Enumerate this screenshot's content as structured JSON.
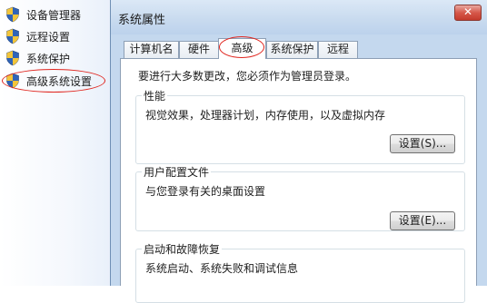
{
  "sidebar": {
    "items": [
      {
        "label": "设备管理器"
      },
      {
        "label": "远程设置"
      },
      {
        "label": "系统保护"
      },
      {
        "label": "高级系统设置"
      }
    ]
  },
  "window": {
    "title": "系统属性",
    "close_glyph": "✕"
  },
  "tabs": [
    {
      "label": "计算机名"
    },
    {
      "label": "硬件"
    },
    {
      "label": "高级",
      "active": true
    },
    {
      "label": "系统保护"
    },
    {
      "label": "远程"
    }
  ],
  "advanced": {
    "admin_note": "要进行大多数更改，您必须作为管理员登录。",
    "performance": {
      "label": "性能",
      "description": "视觉效果，处理器计划，内存使用，以及虚拟内存",
      "button": "设置(S)..."
    },
    "user_profiles": {
      "label": "用户配置文件",
      "description": "与您登录有关的桌面设置",
      "button": "设置(E)..."
    },
    "startup_recovery": {
      "label": "启动和故障恢复",
      "description": "系统启动、系统失败和调试信息"
    }
  },
  "colors": {
    "annotation_red": "#e0261f",
    "titlebar": "#c9dbef",
    "close_button": "#d6584a"
  },
  "icons": {
    "sidebar": "uac-shield-icon",
    "close": "close-icon"
  }
}
